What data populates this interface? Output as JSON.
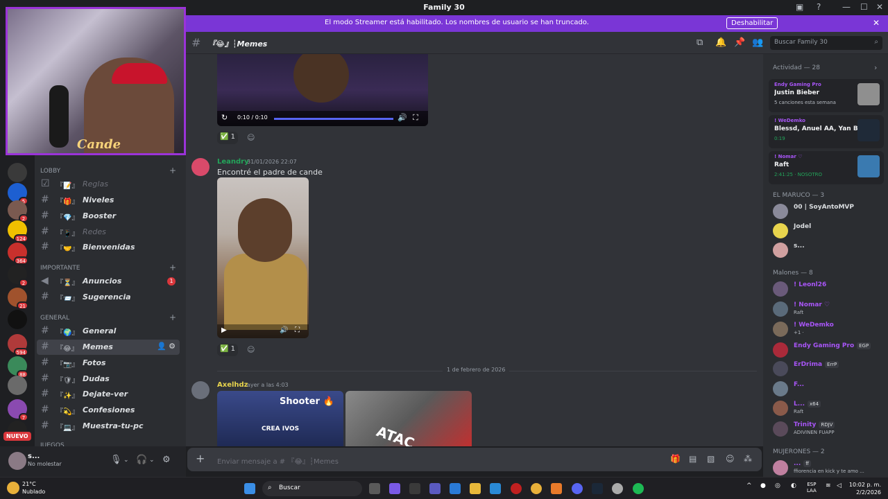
{
  "titlebar": {
    "title": "Family 30"
  },
  "banner": {
    "message": "El modo Streamer está habilitado. Los nombres de usuario se han truncado.",
    "button": "Deshabilitar"
  },
  "guilds": [
    {
      "color": "#3a3a3a",
      "badge": ""
    },
    {
      "color": "#1d5fd1",
      "badge": "5"
    },
    {
      "color": "#7a5a50",
      "badge": "2"
    },
    {
      "color": "#f0c000",
      "badge": "124"
    },
    {
      "color": "#c9302c",
      "badge": "364"
    },
    {
      "color": "#222222",
      "badge": "2"
    },
    {
      "color": "#a0522d",
      "badge": "21"
    },
    {
      "color": "#111111",
      "badge": ""
    },
    {
      "color": "#b03a3a",
      "badge": "594"
    },
    {
      "color": "#3a8a5a",
      "badge": "88"
    },
    {
      "color": "#6a6a6a",
      "badge": ""
    },
    {
      "color": "#8a4ab0",
      "badge": "7"
    },
    {
      "color": "#222222",
      "badge": ""
    }
  ],
  "guild_new_label": "NUEVO",
  "categories": {
    "lobby": "LOBBY",
    "importante": "IMPORTANTE",
    "general": "GENERAL",
    "juegos": "JUEGOS"
  },
  "channels": {
    "reglas": {
      "emoji": "『📝』",
      "name": "Reglas"
    },
    "niveles": {
      "emoji": "『🎁』",
      "name": "Niveles"
    },
    "booster": {
      "emoji": "『💎』",
      "name": "Booster"
    },
    "redes": {
      "emoji": "『📱』",
      "name": "Redes"
    },
    "bienvenidas": {
      "emoji": "『🤝』",
      "name": "Bienvenidas"
    },
    "anuncios": {
      "emoji": "『⏳』",
      "name": "Anuncios",
      "badge": "1"
    },
    "sugerencia": {
      "emoji": "『📨』",
      "name": "Sugerencia"
    },
    "general": {
      "emoji": "『🌍』",
      "name": "General"
    },
    "memes": {
      "emoji": "『😂』",
      "name": "Memes"
    },
    "fotos": {
      "emoji": "『📷』",
      "name": "Fotos"
    },
    "dudas": {
      "emoji": "『🛡』",
      "name": "Dudas"
    },
    "dejate": {
      "emoji": "『✨』",
      "name": "Dejate-ver"
    },
    "confesiones": {
      "emoji": "『💫』",
      "name": "Confesiones"
    },
    "muestra": {
      "emoji": "『💻』",
      "name": "Muestra-tu-pc"
    }
  },
  "user": {
    "name": "s...",
    "status": "No molestar"
  },
  "header": {
    "channel": "『😂』┆Memes",
    "search": "Buscar Family 30"
  },
  "messages": {
    "video1": {
      "time": "0:10 / 0:10",
      "reaction_count": "1"
    },
    "leandry": {
      "author": "Leandry",
      "author_color": "#23a55a",
      "timestamp": "31/01/2026 22:07",
      "text": "Encontré el padre de cande",
      "reaction_count": "1"
    },
    "date_divider": "1 de febrero de 2026",
    "axelhdz": {
      "author": "Axelhdz",
      "author_color": "#e8d44d",
      "timestamp": "ayer a las 4:03",
      "thumb1_text": "Shooter 🔥",
      "thumb1_sub": "CREA IVOS",
      "thumb2_text": "ATAC"
    }
  },
  "composer": {
    "placeholder": "Enviar mensaje a # 『😂』┆Memes"
  },
  "members": {
    "activity_header": "Actividad — 28",
    "activities": [
      {
        "user": "Endy Gaming Pro",
        "title": "Justin Bieber",
        "detail": "5 canciones esta semana",
        "color": "#8f8f8f",
        "green": false
      },
      {
        "user": "! WeDemko",
        "title": "Blessd, Anuel AA, Yan Bloc...",
        "detail": "0:19",
        "color": "#1f2a38",
        "green": true
      },
      {
        "user": "! Nomar ♡",
        "title": "Raft",
        "detail": "2:41:25 · NOSOTRO",
        "color": "#3a7ab0",
        "green": true
      }
    ],
    "groups": [
      {
        "label": "EL MARUCO — 3"
      },
      {
        "label": "Malones — 8"
      },
      {
        "label": "MUJERONES — 2"
      }
    ],
    "maruco": [
      {
        "name": "00 | SoyAntoMVP",
        "status": "",
        "color": "#dbdee1",
        "av": "#8a8a9a"
      },
      {
        "name": "Jodel",
        "status": "",
        "color": "#dbdee1",
        "av": "#e8d44d"
      },
      {
        "name": "s...",
        "status": "",
        "color": "#dbdee1",
        "av": "#d0a0a0"
      }
    ],
    "malones": [
      {
        "name": "! Leonl26",
        "status": "",
        "color": "#a855f7",
        "av": "#6a5a7a",
        "tag": ""
      },
      {
        "name": "! Nomar ♡",
        "status": "Raft",
        "color": "#a855f7",
        "av": "#5a6a7a",
        "tag": ""
      },
      {
        "name": "! WeDemko",
        "status": "+1 ·",
        "color": "#a855f7",
        "av": "#7a6a5a",
        "tag": ""
      },
      {
        "name": "Endy Gaming Pro",
        "status": "",
        "color": "#a855f7",
        "av": "#aa2a3a",
        "tag": "EGP"
      },
      {
        "name": "ErDrima",
        "status": "",
        "color": "#a855f7",
        "av": "#4a4a5a",
        "tag": "ErrP"
      },
      {
        "name": "F...",
        "status": "",
        "color": "#a855f7",
        "av": "#6a7a8a",
        "tag": ""
      },
      {
        "name": "L...",
        "status": "Raft",
        "color": "#a855f7",
        "av": "#8a5a4a",
        "tag": "x64"
      },
      {
        "name": "Trinity",
        "status": "ADIVINEN FUAPP",
        "color": "#a855f7",
        "av": "#5a4a5a",
        "tag": "RDJV"
      }
    ],
    "mujerones": [
      {
        "name": "...",
        "status": "ffiorencia en kick y te amo ...",
        "color": "#a855f7",
        "av": "#c080a0",
        "tag": "ff"
      }
    ]
  },
  "taskbar": {
    "temp": "21°C",
    "weather": "Nublado",
    "search": "Buscar",
    "lang1": "ESP",
    "lang2": "LAA",
    "time": "10:02 p. m.",
    "date": "2/2/2026"
  }
}
